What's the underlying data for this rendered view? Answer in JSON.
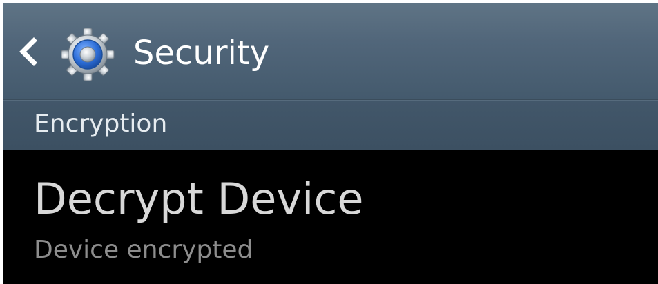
{
  "action_bar": {
    "title": "Security",
    "back_icon": "back-chevron-icon",
    "app_icon": "settings-gear-icon"
  },
  "section": {
    "title": "Encryption"
  },
  "item": {
    "title": "Decrypt Device",
    "summary": "Device encrypted"
  },
  "colors": {
    "action_bar": "#51667a",
    "section_header": "#3f5467",
    "background": "#000000",
    "title_text": "#d8d8d8",
    "summary_text": "#8d8d8d",
    "gear_blue": "#2d6ed8"
  }
}
